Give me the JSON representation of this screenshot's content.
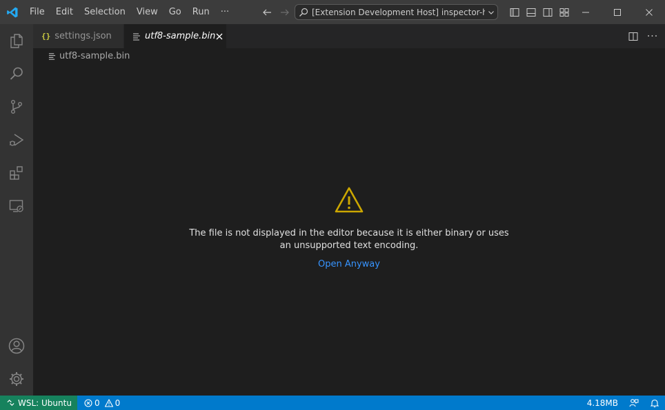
{
  "colors": {
    "titlebar_bg": "#3c3c3c",
    "activitybar_bg": "#333333",
    "editor_bg": "#1e1e1e",
    "statusbar_bg": "#007acc",
    "remote_bg": "#16825d",
    "warning": "#cca700",
    "link": "#3794ff"
  },
  "titlebar": {
    "logo_icon": "vscode-logo-icon",
    "menu": [
      "File",
      "Edit",
      "Selection",
      "View",
      "Go",
      "Run",
      "···"
    ],
    "command_center": "[Extension Development Host] inspector-hex [..."
  },
  "activitybar": {
    "items": [
      "explorer-icon",
      "search-icon",
      "source-control-icon",
      "run-debug-icon",
      "extensions-icon",
      "remote-explorer-icon"
    ],
    "bottom": [
      "account-icon",
      "manage-gear-icon"
    ]
  },
  "tabs": [
    {
      "label": "settings.json",
      "icon": "json-braces-icon",
      "active": false,
      "italic": false
    },
    {
      "label": "utf8-sample.bin",
      "icon": "file-lines-icon",
      "active": true,
      "italic": true
    }
  ],
  "breadcrumb": {
    "label": "utf8-sample.bin"
  },
  "editor": {
    "message_line1": "The file is not displayed in the editor because it is either binary or uses",
    "message_line2": "an unsupported text encoding.",
    "action": "Open Anyway"
  },
  "statusbar": {
    "remote": "WSL: Ubuntu",
    "errors": "0",
    "warnings": "0",
    "memory": "4.18MB"
  }
}
